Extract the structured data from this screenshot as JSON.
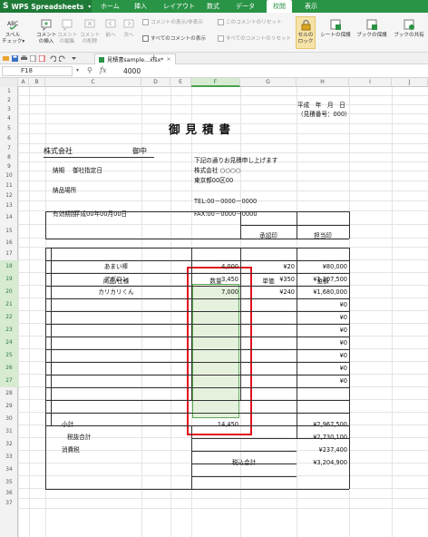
{
  "app": {
    "name": "WPS Spreadsheets",
    "logo": "S"
  },
  "menu_tabs": [
    "ホーム",
    "挿入",
    "レイアウト",
    "数式",
    "データ",
    "校閲",
    "表示"
  ],
  "active_tab_index": 5,
  "ribbon": {
    "spell": "スペル\nチェック▾",
    "insert_comment": "コメント\nの挿入",
    "edit_comment": "コメント\nの編集",
    "delete_comment": "コメント\nの削除",
    "prev": "前へ",
    "next": "次へ",
    "show_hide": "コメントの表示/非表示",
    "reset_comment": "このコメントのリセット",
    "show_all": "すべてのコメントの表示",
    "reset_all": "すべてのコメントのリセット",
    "lock_cell": "セルの\nロック",
    "protect_sheet": "シートの保護",
    "protect_book": "ブックの保護",
    "share_book": "ブックの共有"
  },
  "document_tab": "見積書sample...xlsx*",
  "formula_bar": {
    "cell_ref": "F18",
    "value": "4000"
  },
  "columns": [
    "A",
    "B",
    "C",
    "D",
    "E",
    "F",
    "G",
    "H",
    "I",
    "J"
  ],
  "selected_column": "F",
  "rows": [
    "1",
    "2",
    "3",
    "4",
    "5",
    "6",
    "7",
    "8",
    "9",
    "10",
    "11",
    "12",
    "13",
    "14",
    "15",
    "16",
    "17",
    "18",
    "19",
    "20",
    "21",
    "22",
    "23",
    "24",
    "25",
    "26",
    "27",
    "28",
    "29",
    "30",
    "31",
    "32",
    "33",
    "34",
    "35",
    "36",
    "37"
  ],
  "sheet": {
    "date_line": "平成　年　月　日",
    "estimate_no": "（見積番号：000）",
    "title": "御見積書",
    "company": "株式会社",
    "onchu": "御中",
    "greeting": "下記の通りお見積申し上げます",
    "delivery_label": "納期",
    "delivery_value": "御社指定日",
    "place_label": "納品場所",
    "validity_label": "有効期間",
    "validity_value": "平成00年00月00日",
    "our_company": "株式会社 ○○○○",
    "address": "東京都00区00",
    "tel": "TEL:00－0000－0000",
    "fax": "FAX:00－0000－0000",
    "approval": "承認印",
    "person": "担当印",
    "hdr_item": "商品/仕様",
    "hdr_qty": "数量",
    "hdr_price": "単価",
    "hdr_amount": "金額",
    "items": [
      {
        "name": "あまい棒",
        "qty": "4,000",
        "price": "¥20",
        "amount": "¥80,000"
      },
      {
        "name": "アポロン",
        "qty": "3,450",
        "price": "¥350",
        "amount": "¥1,207,500"
      },
      {
        "name": "カリカリくん",
        "qty": "7,000",
        "price": "¥240",
        "amount": "¥1,680,000"
      },
      {
        "name": "",
        "qty": "",
        "price": "",
        "amount": "¥0"
      },
      {
        "name": "",
        "qty": "",
        "price": "",
        "amount": "¥0"
      },
      {
        "name": "",
        "qty": "",
        "price": "",
        "amount": "¥0"
      },
      {
        "name": "",
        "qty": "",
        "price": "",
        "amount": "¥0"
      },
      {
        "name": "",
        "qty": "",
        "price": "",
        "amount": "¥0"
      },
      {
        "name": "",
        "qty": "",
        "price": "",
        "amount": "¥0"
      },
      {
        "name": "",
        "qty": "",
        "price": "",
        "amount": "¥0"
      }
    ],
    "subtotal_label": "小計",
    "subtotal_qty": "14,450",
    "subtotal_amount": "¥2,967,500",
    "pretax_label": "税抜合計",
    "pretax_amount": "¥2,730,100",
    "tax_label": "消費税",
    "tax_amount": "¥237,400",
    "total_label": "税込合計",
    "total_amount": "¥3,204,900"
  },
  "colors": {
    "accent": "#2a9446",
    "selection_fill": "#e6f1dd",
    "highlight_box": "#e0101e"
  }
}
